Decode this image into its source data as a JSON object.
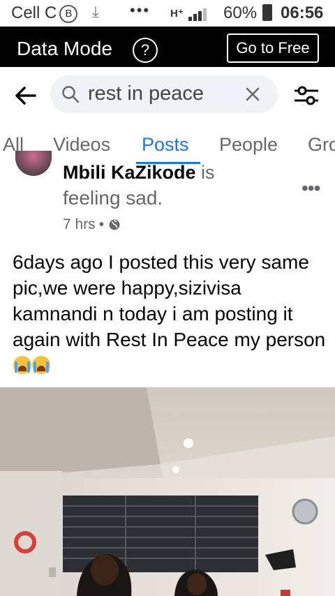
{
  "status_bar": {
    "carrier": "Cell C",
    "carrier_badge": "B",
    "overflow": "•••",
    "network": "H⁺",
    "battery": "60%",
    "time": "06:56"
  },
  "data_mode_bar": {
    "title": "Data Mode",
    "help_label": "?",
    "go_free_label": "Go to Free"
  },
  "search": {
    "query": "rest in peace",
    "icons": [
      "back-arrow-icon",
      "search-icon",
      "clear-icon",
      "filter-icon"
    ]
  },
  "tabs": [
    {
      "label": "All",
      "active": false
    },
    {
      "label": "Videos",
      "active": false
    },
    {
      "label": "Posts",
      "active": true
    },
    {
      "label": "People",
      "active": false
    },
    {
      "label": "Gro",
      "active": false
    }
  ],
  "post": {
    "author": "Mbili KaZikode",
    "feeling_prefix": "is",
    "feeling": "feeling sad.",
    "time": "7 hrs",
    "separator": "•",
    "privacy_icon": "globe-icon",
    "more_label": "•••",
    "body": "6days ago I posted this very same pic,we were happy,sizivisa kamnandi n today i am posting it again with Rest In Peace my person",
    "reaction_emoji": [
      "crying-face-icon",
      "crying-face-icon"
    ]
  },
  "colors": {
    "accent": "#1877f2",
    "data_bar_bg": "#000000",
    "secondary_text": "#65676b"
  }
}
